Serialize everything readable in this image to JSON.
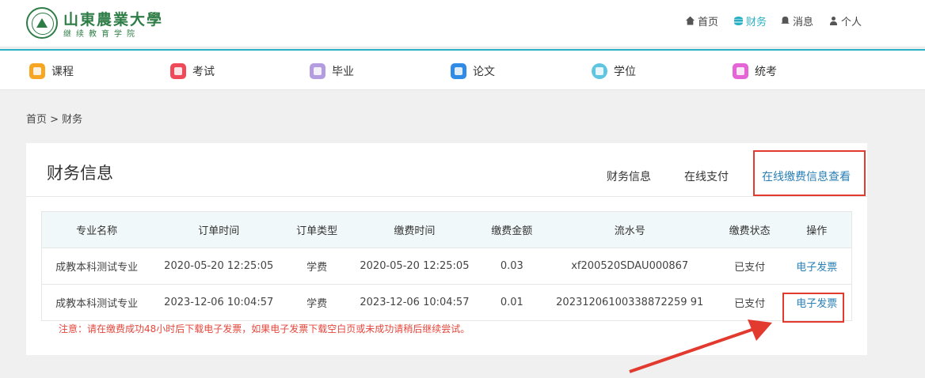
{
  "header": {
    "school_name": "山東農業大學",
    "school_sub": "继续教育学院",
    "nav": [
      {
        "label": "首页",
        "icon": "home-icon"
      },
      {
        "label": "财务",
        "icon": "database-icon",
        "active": true
      },
      {
        "label": "消息",
        "icon": "bell-icon"
      },
      {
        "label": "个人",
        "icon": "user-icon"
      }
    ]
  },
  "modules": [
    {
      "label": "课程",
      "icon": "course-icon",
      "color": "#f6a623"
    },
    {
      "label": "考试",
      "icon": "exam-icon",
      "color": "#ef4a5a"
    },
    {
      "label": "毕业",
      "icon": "graduation-icon",
      "color": "#b39ce0"
    },
    {
      "label": "论文",
      "icon": "paper-icon",
      "color": "#2f8be6"
    },
    {
      "label": "学位",
      "icon": "degree-icon",
      "color": "#5fc5e0"
    },
    {
      "label": "统考",
      "icon": "unified-exam-icon",
      "color": "#e565d6"
    }
  ],
  "breadcrumb": "首页 > 财务",
  "panel": {
    "title": "财务信息",
    "tabs": [
      "财务信息",
      "在线支付",
      "在线缴费信息查看"
    ],
    "active_tab": "在线缴费信息查看"
  },
  "table": {
    "headers": [
      "专业名称",
      "订单时间",
      "订单类型",
      "缴费时间",
      "缴费金额",
      "流水号",
      "缴费状态",
      "操作"
    ],
    "rows": [
      {
        "major": "成教本科测试专业",
        "order_time": "2020-05-20 12:25:05",
        "order_type": "学费",
        "pay_time": "2020-05-20 12:25:05",
        "amount": "0.03",
        "serial": "xf200520SDAU000867",
        "status": "已支付",
        "action": "电子发票"
      },
      {
        "major": "成教本科测试专业",
        "order_time": "2023-12-06 10:04:57",
        "order_type": "学费",
        "pay_time": "2023-12-06 10:04:57",
        "amount": "0.01",
        "serial": "20231206100338872259 91",
        "status": "已支付",
        "action": "电子发票"
      }
    ]
  },
  "note": "注意：请在缴费成功48小时后下载电子发票，如果电子发票下载空白页或未成功请稍后继续尝试。",
  "colors": {
    "accent": "#2ab0c5",
    "link": "#2a7fb5",
    "highlight": "#e23a2f",
    "brand": "#2e7d46"
  }
}
